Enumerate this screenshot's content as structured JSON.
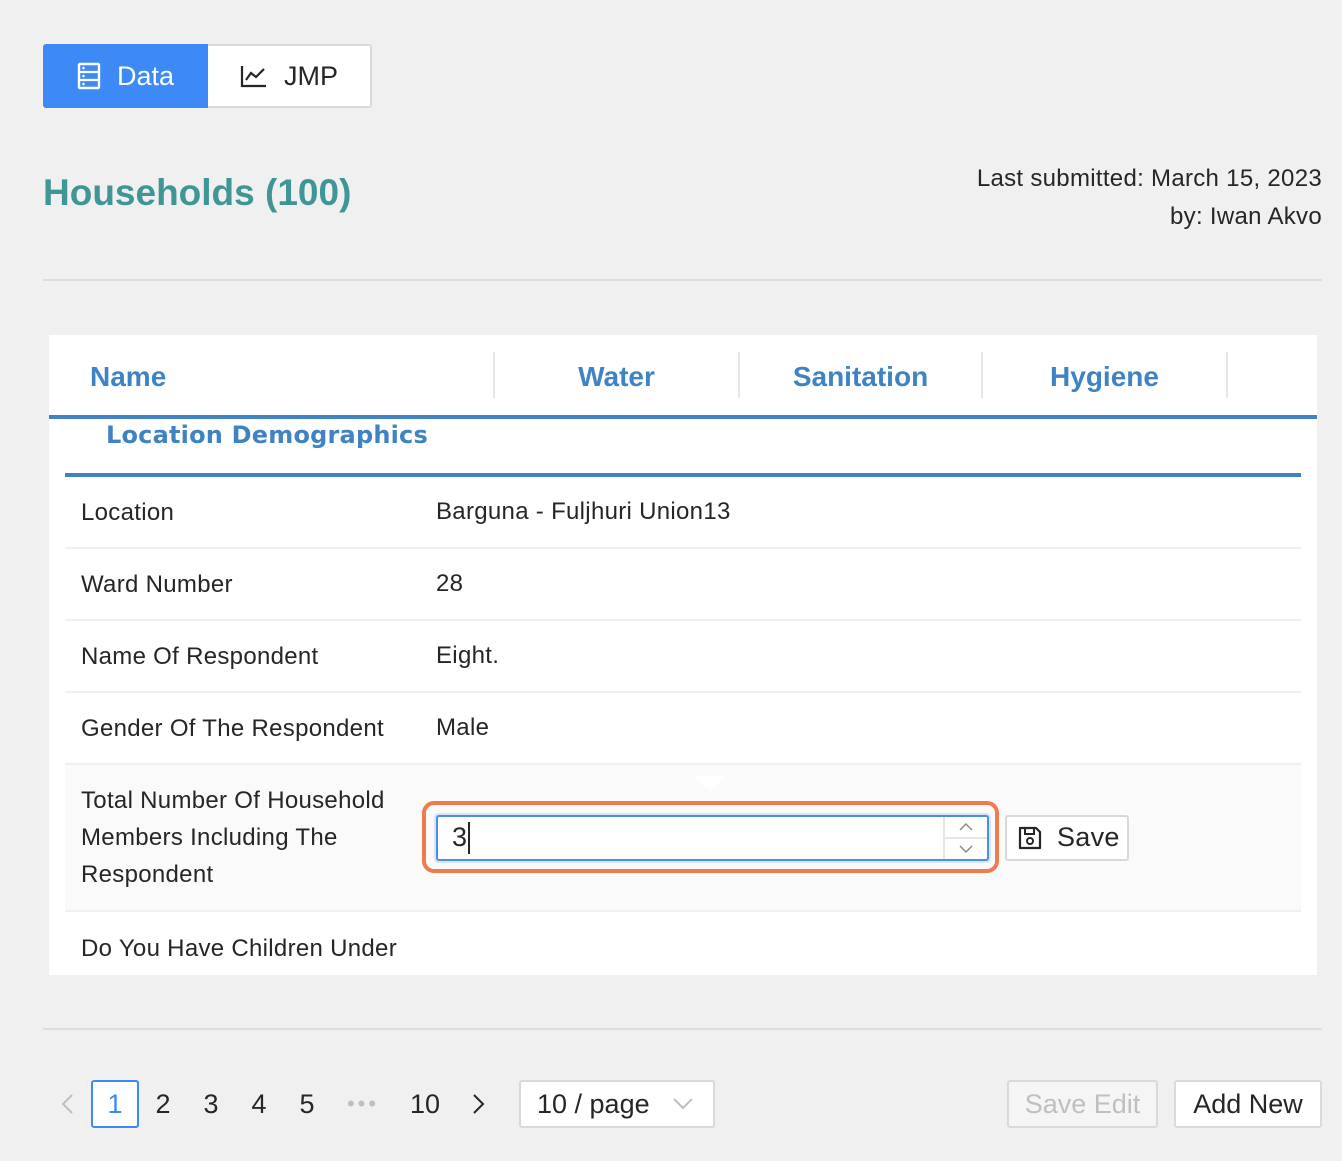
{
  "toggle": {
    "data_label": "Data",
    "jmp_label": "JMP"
  },
  "header": {
    "title": "Households (100)",
    "last_submitted": "Last submitted: March 15, 2023",
    "submitted_by": "by: Iwan Akvo"
  },
  "tabs": [
    "Name",
    "Water",
    "Sanitation",
    "Hygiene"
  ],
  "section_title": "Location Demographics",
  "rows": [
    {
      "label": "Location",
      "value": "Barguna - Fuljhuri Union13"
    },
    {
      "label": "Ward Number",
      "value": "28"
    },
    {
      "label": "Name Of Respondent",
      "value": "Eight."
    },
    {
      "label": "Gender Of The Respondent",
      "value": "Male"
    },
    {
      "label": "Total Number Of Household Members Including The Respondent",
      "value": ""
    },
    {
      "label": "Do You Have Children Under",
      "value": ""
    }
  ],
  "edit": {
    "input_value": "3",
    "save_label": "Save"
  },
  "pagination": {
    "pages": [
      "1",
      "2",
      "3",
      "4",
      "5"
    ],
    "ellipsis": "•••",
    "last_page": "10",
    "current": "1",
    "page_size": "10 / page"
  },
  "actions": {
    "save_edit": "Save Edit",
    "add_new": "Add New"
  },
  "colors": {
    "primary": "#3d8af7",
    "title": "#409696",
    "tab": "#3f83c4",
    "focus_ring": "#ee7c4c"
  }
}
